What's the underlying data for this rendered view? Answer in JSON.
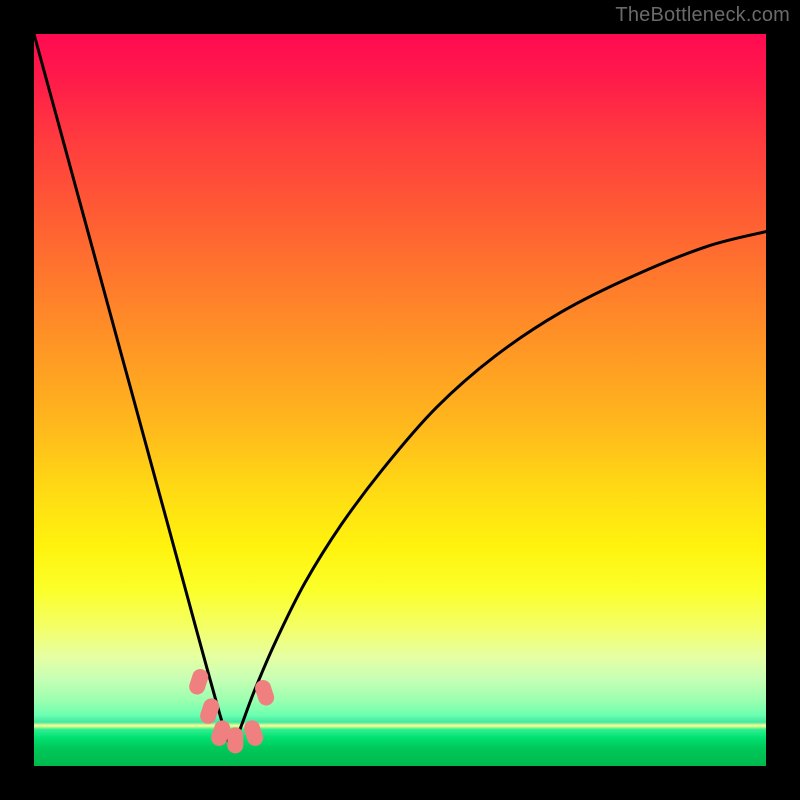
{
  "watermark": "TheBottleneck.com",
  "colors": {
    "frame": "#000000",
    "curve": "#000000",
    "beads": "#f08080"
  },
  "chart_data": {
    "type": "line",
    "title": "",
    "xlabel": "",
    "ylabel": "",
    "xlim": [
      0,
      1
    ],
    "ylim": [
      0,
      1
    ],
    "notes": "Axes are unlabeled; values are normalized 0–1 estimates from pixel positions. y is plotted inverted (0 at top, 1 at bottom). Curve resembles a bottleneck/V shape with minimum near x≈0.27.",
    "series": [
      {
        "name": "curve",
        "x": [
          0.0,
          0.03,
          0.06,
          0.09,
          0.12,
          0.15,
          0.18,
          0.21,
          0.24,
          0.265,
          0.275,
          0.3,
          0.33,
          0.37,
          0.42,
          0.48,
          0.55,
          0.63,
          0.72,
          0.82,
          0.92,
          1.0
        ],
        "y": [
          0.0,
          0.11,
          0.22,
          0.33,
          0.44,
          0.55,
          0.66,
          0.77,
          0.88,
          0.965,
          0.965,
          0.9,
          0.83,
          0.75,
          0.67,
          0.59,
          0.51,
          0.44,
          0.38,
          0.33,
          0.29,
          0.27
        ]
      }
    ],
    "markers": [
      {
        "x": 0.225,
        "y": 0.885
      },
      {
        "x": 0.24,
        "y": 0.925
      },
      {
        "x": 0.255,
        "y": 0.955
      },
      {
        "x": 0.275,
        "y": 0.965
      },
      {
        "x": 0.3,
        "y": 0.955
      },
      {
        "x": 0.315,
        "y": 0.9
      }
    ]
  }
}
